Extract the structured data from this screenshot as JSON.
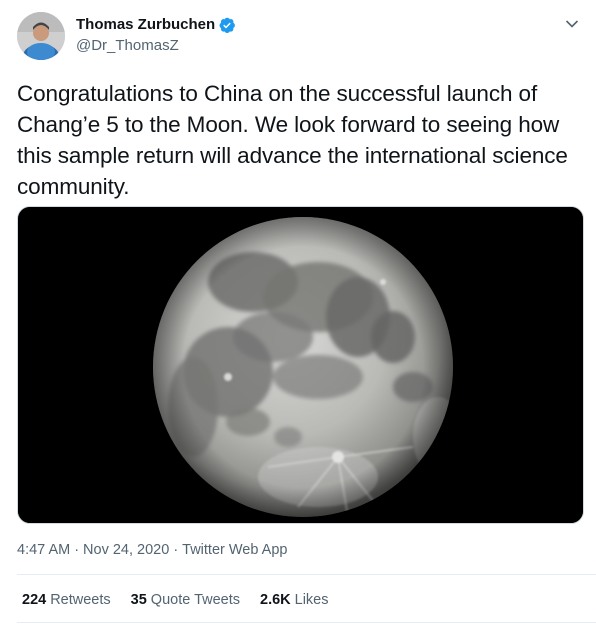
{
  "author": {
    "display_name": "Thomas Zurbuchen",
    "handle": "@Dr_ThomasZ",
    "verified": true
  },
  "tweet": {
    "text": "Congratulations to China on the successful launch of Chang’e 5 to the Moon. We look forward to seeing how this sample return will advance the international science community."
  },
  "meta": {
    "time": "4:47 AM",
    "separator": "·",
    "date": "Nov 24, 2020",
    "source": "Twitter Web App"
  },
  "stats": {
    "retweets_count": "224",
    "retweets_label": "Retweets",
    "quote_count": "35",
    "quote_label": "Quote Tweets",
    "likes_count": "2.6K",
    "likes_label": "Likes"
  },
  "icons": {
    "verified": "verified-badge-icon",
    "caret": "chevron-down-icon"
  },
  "colors": {
    "verified": "#1d9bf0",
    "muted": "#536471",
    "text": "#0f1419"
  }
}
